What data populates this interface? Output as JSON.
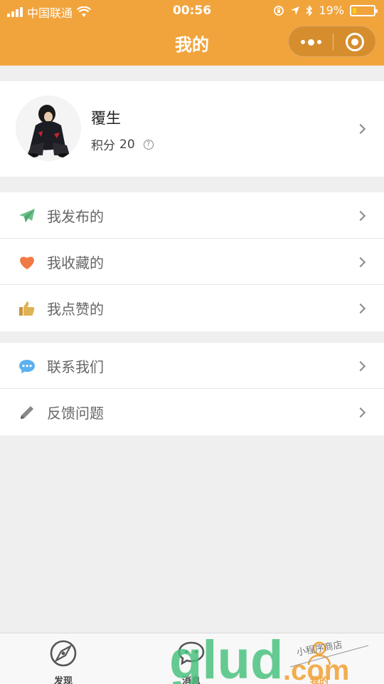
{
  "status_bar": {
    "carrier": "中国联通",
    "time": "00:56",
    "battery_percent": "19%",
    "battery_level": 0.19,
    "icons": [
      "signal-icon",
      "wifi-icon",
      "rotation-lock-icon",
      "location-icon",
      "bluetooth-icon",
      "battery-icon"
    ]
  },
  "nav": {
    "title": "我的",
    "more_icon": "more-dots-icon",
    "close_icon": "target-icon"
  },
  "profile": {
    "name": "覆生",
    "points_label": "积分",
    "points_value": "20",
    "help_icon": "?"
  },
  "menu_group_1": [
    {
      "label": "我发布的",
      "icon": "paper-plane-icon",
      "color": "#6cc28a"
    },
    {
      "label": "我收藏的",
      "icon": "heart-icon",
      "color": "#f07a46"
    },
    {
      "label": "我点赞的",
      "icon": "thumbs-up-icon",
      "color": "#c9963a"
    }
  ],
  "menu_group_2": [
    {
      "label": "联系我们",
      "icon": "chat-bubble-icon",
      "color": "#5bb0f0"
    },
    {
      "label": "反馈问题",
      "icon": "pencil-icon",
      "color": "#888888"
    }
  ],
  "tab_bar": {
    "tabs": [
      {
        "label": "发现",
        "icon": "compass-icon"
      },
      {
        "label": "消息",
        "icon": "message-icon"
      },
      {
        "label": "我的",
        "icon": "user-icon"
      }
    ],
    "active_color": "#f1a43c"
  },
  "watermark": {
    "text_main": "glud",
    "text_com": ".com",
    "text_small": "小程序商店"
  },
  "colors": {
    "accent": "#f1a43c",
    "background": "#efeff0"
  }
}
